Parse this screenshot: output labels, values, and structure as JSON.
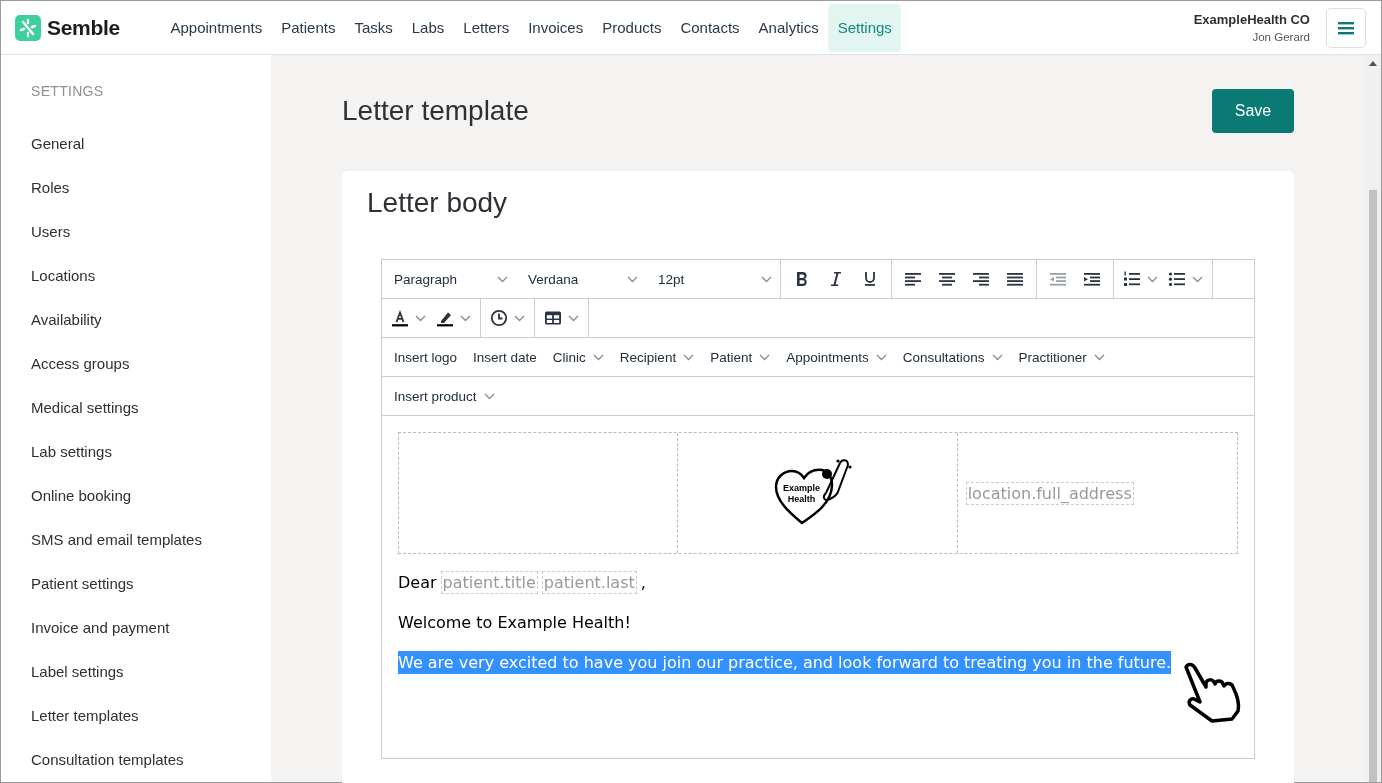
{
  "brand": {
    "name": "Semble"
  },
  "nav": [
    {
      "label": "Appointments",
      "selected": false
    },
    {
      "label": "Patients",
      "selected": false
    },
    {
      "label": "Tasks",
      "selected": false
    },
    {
      "label": "Labs",
      "selected": false
    },
    {
      "label": "Letters",
      "selected": false
    },
    {
      "label": "Invoices",
      "selected": false
    },
    {
      "label": "Products",
      "selected": false
    },
    {
      "label": "Contacts",
      "selected": false
    },
    {
      "label": "Analytics",
      "selected": false
    },
    {
      "label": "Settings",
      "selected": true
    }
  ],
  "account": {
    "organisation": "ExampleHealth CO",
    "user": "Jon Gerard"
  },
  "sidebar": {
    "heading": "SETTINGS",
    "items": [
      "General",
      "Roles",
      "Users",
      "Locations",
      "Availability",
      "Access groups",
      "Medical settings",
      "Lab settings",
      "Online booking",
      "SMS and email templates",
      "Patient settings",
      "Invoice and payment",
      "Label settings",
      "Letter templates",
      "Consultation templates"
    ]
  },
  "page": {
    "title": "Letter template",
    "save_button": "Save"
  },
  "card": {
    "title": "Letter body"
  },
  "editor": {
    "selects": [
      "Paragraph",
      "Verdana",
      "12pt"
    ],
    "insert_menu": [
      {
        "label": "Insert logo",
        "kind": "button"
      },
      {
        "label": "Insert date",
        "kind": "button"
      },
      {
        "label": "Clinic",
        "kind": "menu"
      },
      {
        "label": "Recipient",
        "kind": "menu"
      },
      {
        "label": "Patient",
        "kind": "menu"
      },
      {
        "label": "Appointments",
        "kind": "menu"
      },
      {
        "label": "Consultations",
        "kind": "menu"
      },
      {
        "label": "Practitioner",
        "kind": "menu"
      },
      {
        "label": "Insert product",
        "kind": "menu"
      }
    ],
    "header_cells": [
      {
        "kind": "empty"
      },
      {
        "kind": "logo",
        "lines": [
          "Example",
          "Health"
        ]
      },
      {
        "kind": "field",
        "text": "location.full_address"
      }
    ],
    "paragraphs": [
      {
        "selected": false,
        "segments": [
          {
            "kind": "text",
            "text": "Dear"
          },
          {
            "kind": "field",
            "text": "patient.title"
          },
          {
            "kind": "field",
            "text": "patient.last"
          },
          {
            "kind": "text",
            "text": ","
          }
        ]
      },
      {
        "selected": false,
        "segments": [
          {
            "kind": "text",
            "text": "Welcome to Example Health!"
          }
        ]
      },
      {
        "selected": true,
        "segments": [
          {
            "kind": "text",
            "text": "We are very excited to have you join our practice, and look forward to treating you in the future."
          }
        ]
      }
    ]
  }
}
